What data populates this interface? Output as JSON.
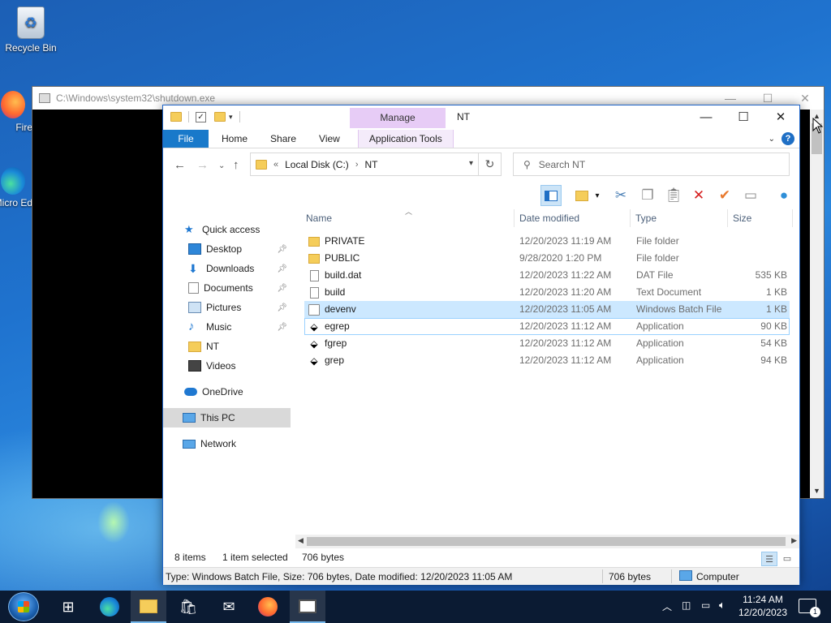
{
  "desktop": {
    "icons": [
      {
        "label": "Recycle Bin"
      },
      {
        "label": "Fire"
      },
      {
        "label": "Micro Ed"
      }
    ]
  },
  "console_window": {
    "title": "C:\\Windows\\system32\\shutdown.exe"
  },
  "explorer": {
    "title": "NT",
    "contextual_tab": "Manage",
    "ribbon_tabs": [
      "File",
      "Home",
      "Share",
      "View",
      "Application Tools"
    ],
    "address": {
      "overflow": "«",
      "crumbs": [
        "Local Disk (C:)",
        "NT"
      ]
    },
    "search": {
      "placeholder": "Search NT"
    },
    "nav_pane": [
      {
        "label": "Quick access",
        "pinned": false
      },
      {
        "label": "Desktop",
        "pinned": true
      },
      {
        "label": "Downloads",
        "pinned": true
      },
      {
        "label": "Documents",
        "pinned": true
      },
      {
        "label": "Pictures",
        "pinned": true
      },
      {
        "label": "Music",
        "pinned": true
      },
      {
        "label": "NT",
        "pinned": false
      },
      {
        "label": "Videos",
        "pinned": false
      },
      {
        "label": "OneDrive",
        "pinned": false
      },
      {
        "label": "This PC",
        "pinned": false
      },
      {
        "label": "Network",
        "pinned": false
      }
    ],
    "columns": [
      "Name",
      "Date modified",
      "Type",
      "Size"
    ],
    "files": [
      {
        "name": "PRIVATE",
        "date": "12/20/2023 11:19 AM",
        "type": "File folder",
        "size": "",
        "icon": "folder-icon"
      },
      {
        "name": "PUBLIC",
        "date": "9/28/2020 1:20 PM",
        "type": "File folder",
        "size": "",
        "icon": "folder-icon"
      },
      {
        "name": "build.dat",
        "date": "12/20/2023 11:22 AM",
        "type": "DAT File",
        "size": "535 KB",
        "icon": "file-icon"
      },
      {
        "name": "build",
        "date": "12/20/2023 11:20 AM",
        "type": "Text Document",
        "size": "1 KB",
        "icon": "text-file-icon"
      },
      {
        "name": "devenv",
        "date": "12/20/2023 11:05 AM",
        "type": "Windows Batch File",
        "size": "1 KB",
        "icon": "batch-file-icon"
      },
      {
        "name": "egrep",
        "date": "12/20/2023 11:12 AM",
        "type": "Application",
        "size": "90 KB",
        "icon": "application-icon"
      },
      {
        "name": "fgrep",
        "date": "12/20/2023 11:12 AM",
        "type": "Application",
        "size": "54 KB",
        "icon": "application-icon"
      },
      {
        "name": "grep",
        "date": "12/20/2023 11:12 AM",
        "type": "Application",
        "size": "94 KB",
        "icon": "application-icon"
      }
    ],
    "status": {
      "items": "8 items",
      "selected": "1 item selected",
      "bytes": "706 bytes"
    },
    "info_bar": {
      "details": "Type: Windows Batch File, Size: 706 bytes, Date modified: 12/20/2023 11:05 AM",
      "size": "706 bytes",
      "location": "Computer"
    }
  },
  "taskbar": {
    "time": "11:24 AM",
    "date": "12/20/2023",
    "notification_count": "1"
  },
  "colors": {
    "accent": "#1979ca",
    "manage_tab": "#e7ccf6",
    "selection": "#cce8ff",
    "taskbar": "#0b1b33"
  }
}
